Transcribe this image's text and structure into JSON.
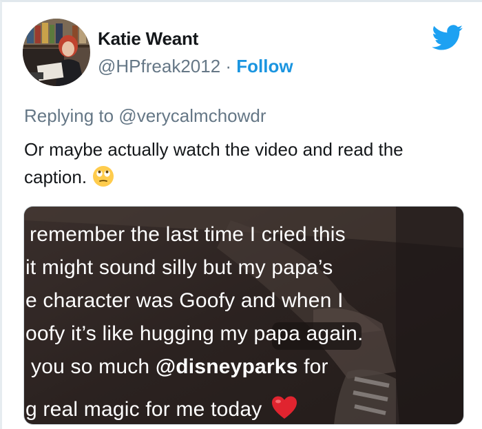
{
  "tweet": {
    "author": {
      "display_name": "Katie Weant",
      "handle": "@HPfreak2012",
      "separator": "·",
      "follow_label": "Follow"
    },
    "brand_icon": "twitter-bird-icon",
    "replying_to": "Replying to @verycalmchowdr",
    "text": "Or maybe actually watch the video and read the caption.",
    "emoji": "face-with-rolling-eyes-icon",
    "media": {
      "caption_lines": [
        "remember the last time I cried this",
        "it might sound silly but my papa’s",
        "e character was Goofy and when I",
        "oofy it’s like hugging my papa again.",
        {
          "before": "you so much ",
          "mention": "@disneyparks",
          "after": " for"
        },
        "g real magic for me today"
      ],
      "caption_emoji": "red-heart-icon"
    }
  },
  "colors": {
    "brand": "#1da1f2",
    "link": "#1b95e0",
    "secondary_text": "#657786",
    "primary_text": "#14171a"
  }
}
